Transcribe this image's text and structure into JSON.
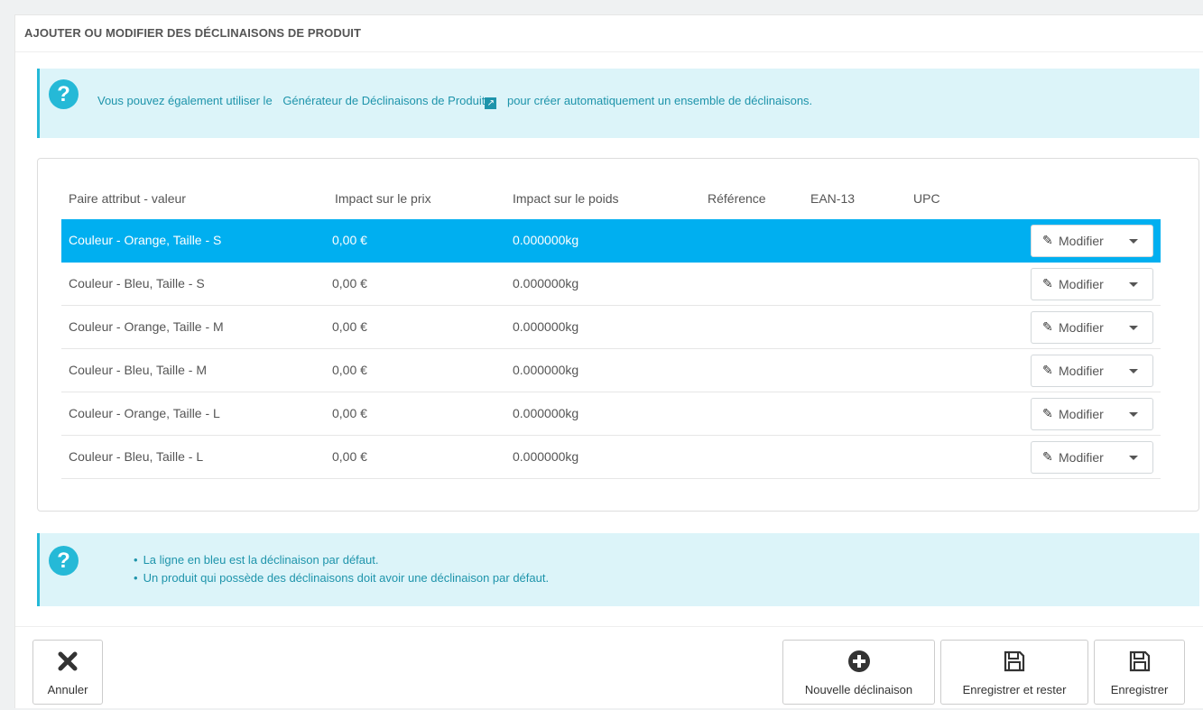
{
  "panel": {
    "title": "AJOUTER OU MODIFIER DES DÉCLINAISONS DE PRODUIT"
  },
  "info_top": {
    "before": "Vous pouvez également utiliser le",
    "link": "Générateur de Déclinaisons de Produit",
    "after": "pour créer automatiquement un ensemble de déclinaisons."
  },
  "table": {
    "headers": [
      "Paire attribut - valeur",
      "Impact sur le prix",
      "Impact sur le poids",
      "Référence",
      "EAN-13",
      "UPC"
    ],
    "rows": [
      {
        "attr": "Couleur - Orange, Taille - S",
        "price": "0,00 €",
        "weight": "0.000000kg",
        "button": "Modifier",
        "selected": true
      },
      {
        "attr": "Couleur - Bleu, Taille - S",
        "price": "0,00 €",
        "weight": "0.000000kg",
        "button": "Modifier",
        "selected": false
      },
      {
        "attr": "Couleur - Orange, Taille - M",
        "price": "0,00 €",
        "weight": "0.000000kg",
        "button": "Modifier",
        "selected": false
      },
      {
        "attr": "Couleur - Bleu, Taille - M",
        "price": "0,00 €",
        "weight": "0.000000kg",
        "button": "Modifier",
        "selected": false
      },
      {
        "attr": "Couleur - Orange, Taille - L",
        "price": "0,00 €",
        "weight": "0.000000kg",
        "button": "Modifier",
        "selected": false
      },
      {
        "attr": "Couleur - Bleu, Taille - L",
        "price": "0,00 €",
        "weight": "0.000000kg",
        "button": "Modifier",
        "selected": false
      }
    ]
  },
  "info_bottom": {
    "items": [
      "La ligne en bleu est la déclinaison par défaut.",
      "Un produit qui possède des déclinaisons doit avoir une déclinaison par défaut."
    ]
  },
  "footer": {
    "cancel": "Annuler",
    "new": "Nouvelle déclinaison",
    "save_stay": "Enregistrer et rester",
    "save": "Enregistrer"
  },
  "icons": {
    "help": "question-circle-icon",
    "external": "external-link-icon",
    "edit": "pencil-icon",
    "dropdown": "caret-down-icon",
    "cancel": "close-icon",
    "new": "plus-circle-icon",
    "save": "floppy-disk-icon"
  },
  "colors": {
    "selected_row": "#00aff0",
    "alert_bg": "#dcf4f9",
    "alert_text": "#1e94ab",
    "help_icon": "#25b9d7"
  }
}
